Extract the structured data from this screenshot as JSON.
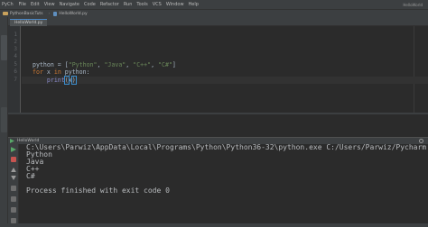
{
  "menubar": {
    "app_name": "PyCh",
    "items": [
      "File",
      "Edit",
      "View",
      "Navigate",
      "Code",
      "Refactor",
      "Run",
      "Tools",
      "VCS",
      "Window",
      "Help"
    ],
    "right_text": "HelloWorld"
  },
  "navbar": {
    "project": "PythonBasicTuts",
    "file": "HelloWorld.py"
  },
  "editor": {
    "tab_label": "HelloWorld.py",
    "line_numbers": [
      "1",
      "2",
      "3",
      "4",
      "5",
      "6",
      "7"
    ],
    "line5": {
      "var": "python",
      "eq": " = [",
      "s1": "\"Python\"",
      "c1": ", ",
      "s2": "\"Java\"",
      "c2": ", ",
      "s3": "\"C++\"",
      "c3": ", ",
      "s4": "\"C#\"",
      "end": "]"
    },
    "line6": {
      "kw_for": "for",
      "mid1": " x ",
      "kw_in": "in",
      "rest": " python:"
    },
    "line7": {
      "indent": "    ",
      "fn": "print",
      "open": "(",
      "arg": "x",
      "close": ")"
    }
  },
  "run_panel": {
    "tab_label": "HelloWorld",
    "output_lines": [
      "C:\\Users\\Parwiz\\AppData\\Local\\Programs\\Python\\Python36-32\\python.exe C:/Users/Parwiz/Pycharm",
      "Python",
      "Java",
      "C++",
      "C#",
      "",
      "Process finished with exit code 0"
    ]
  },
  "colors": {
    "keyword": "#cc7832",
    "string": "#6a8759",
    "builtin": "#8888c6",
    "text": "#a9b7c6",
    "background": "#2b2b2b"
  }
}
